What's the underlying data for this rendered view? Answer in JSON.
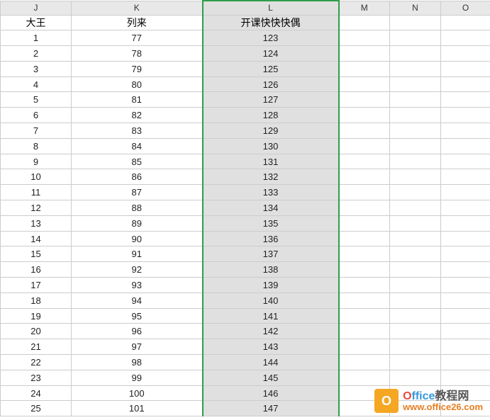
{
  "columns": [
    "J",
    "K",
    "L",
    "M",
    "N",
    "O"
  ],
  "header_row": {
    "J": "大王",
    "K": "列来",
    "L": "开课快快快偶",
    "M": "",
    "N": "",
    "O": ""
  },
  "rows": [
    {
      "J": "1",
      "K": "77",
      "L": "123"
    },
    {
      "J": "2",
      "K": "78",
      "L": "124"
    },
    {
      "J": "3",
      "K": "79",
      "L": "125"
    },
    {
      "J": "4",
      "K": "80",
      "L": "126"
    },
    {
      "J": "5",
      "K": "81",
      "L": "127"
    },
    {
      "J": "6",
      "K": "82",
      "L": "128"
    },
    {
      "J": "7",
      "K": "83",
      "L": "129"
    },
    {
      "J": "8",
      "K": "84",
      "L": "130"
    },
    {
      "J": "9",
      "K": "85",
      "L": "131"
    },
    {
      "J": "10",
      "K": "86",
      "L": "132"
    },
    {
      "J": "11",
      "K": "87",
      "L": "133"
    },
    {
      "J": "12",
      "K": "88",
      "L": "134"
    },
    {
      "J": "13",
      "K": "89",
      "L": "135"
    },
    {
      "J": "14",
      "K": "90",
      "L": "136"
    },
    {
      "J": "15",
      "K": "91",
      "L": "137"
    },
    {
      "J": "16",
      "K": "92",
      "L": "138"
    },
    {
      "J": "17",
      "K": "93",
      "L": "139"
    },
    {
      "J": "18",
      "K": "94",
      "L": "140"
    },
    {
      "J": "19",
      "K": "95",
      "L": "141"
    },
    {
      "J": "20",
      "K": "96",
      "L": "142"
    },
    {
      "J": "21",
      "K": "97",
      "L": "143"
    },
    {
      "J": "22",
      "K": "98",
      "L": "144"
    },
    {
      "J": "23",
      "K": "99",
      "L": "145"
    },
    {
      "J": "24",
      "K": "100",
      "L": "146"
    },
    {
      "J": "25",
      "K": "101",
      "L": "147"
    }
  ],
  "selected_column": "L",
  "watermark": {
    "title_parts": [
      "O",
      "ffice",
      "教程网"
    ],
    "url": "www.office26.com"
  }
}
